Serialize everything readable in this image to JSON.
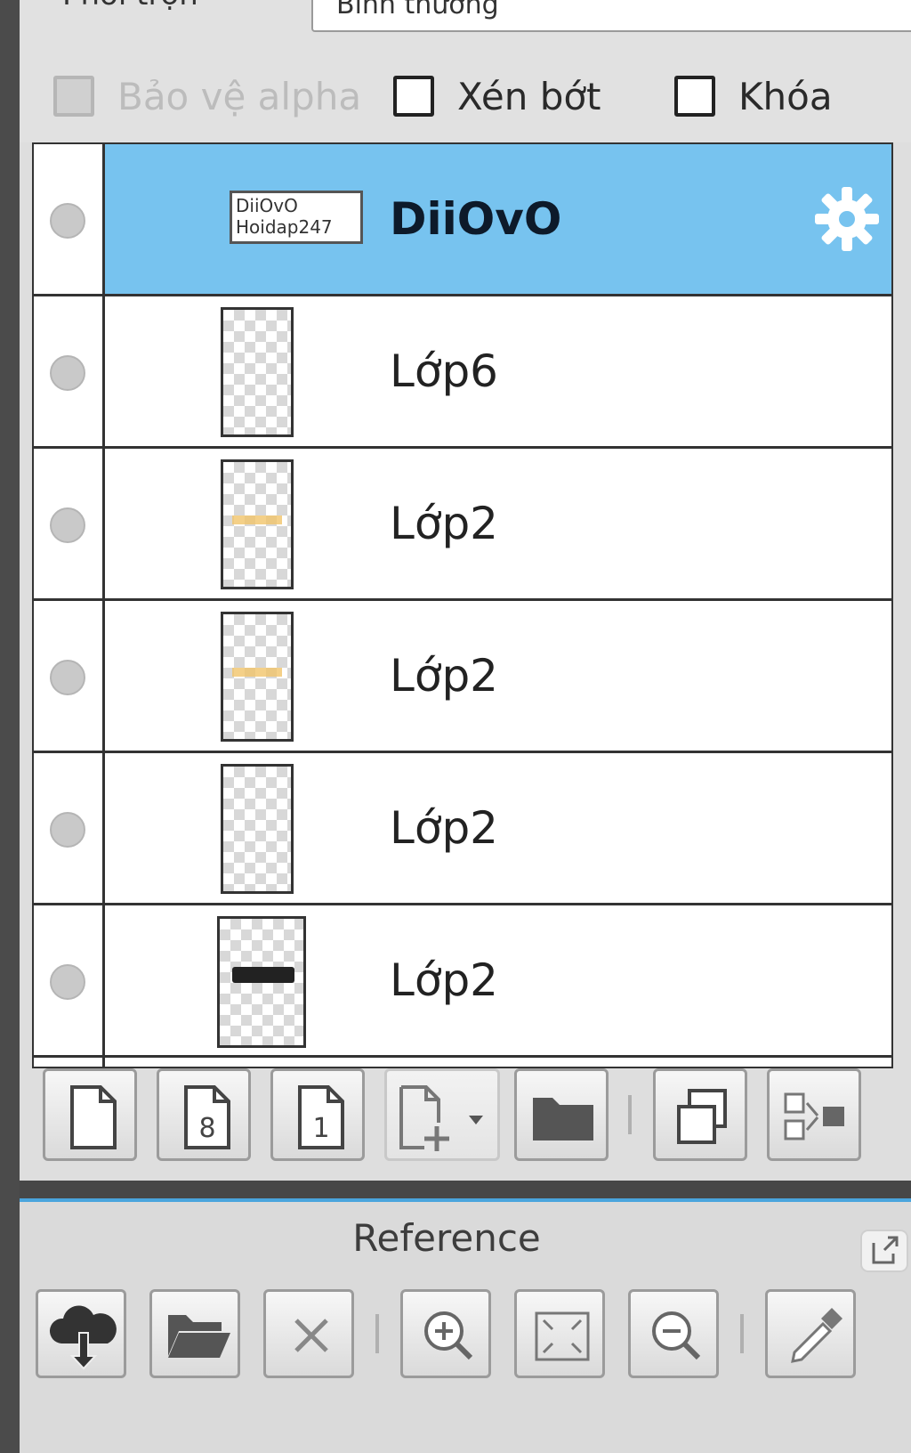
{
  "blend": {
    "label": "Phối trộn",
    "value": "Bình thường"
  },
  "options": {
    "protect_alpha": {
      "label": "Bảo vệ alpha",
      "checked": false,
      "disabled": true
    },
    "clip": {
      "label": "Xén bớt",
      "checked": false
    },
    "lock": {
      "label": "Khóa",
      "checked": false
    }
  },
  "layers": [
    {
      "name": "DiiOvO",
      "type": "group",
      "selected": true,
      "thumb_text": [
        "DiiOvO",
        "Hoidap247"
      ]
    },
    {
      "name": "Lớp6",
      "selected": false
    },
    {
      "name": "Lớp2",
      "selected": false
    },
    {
      "name": "Lớp2",
      "selected": false
    },
    {
      "name": "Lớp2",
      "selected": false
    },
    {
      "name": "Lớp2",
      "selected": false
    }
  ],
  "layer_toolbar": [
    {
      "icon": "new-layer-icon"
    },
    {
      "icon": "new-8bit-layer-icon"
    },
    {
      "icon": "new-1bit-layer-icon"
    },
    {
      "icon": "add-layer-dropdown-icon"
    },
    {
      "icon": "folder-icon"
    },
    {
      "icon": "duplicate-layer-icon"
    },
    {
      "icon": "merge-layer-icon"
    }
  ],
  "reference": {
    "title": "Reference",
    "buttons": [
      {
        "icon": "cloud-download-icon"
      },
      {
        "icon": "open-folder-icon"
      },
      {
        "icon": "close-icon"
      },
      {
        "icon": "zoom-in-icon"
      },
      {
        "icon": "fit-screen-icon"
      },
      {
        "icon": "zoom-out-icon"
      },
      {
        "icon": "eyedropper-icon"
      }
    ]
  },
  "colors": {
    "selection": "#77c3ef",
    "accent_line": "#4aa5dd"
  }
}
